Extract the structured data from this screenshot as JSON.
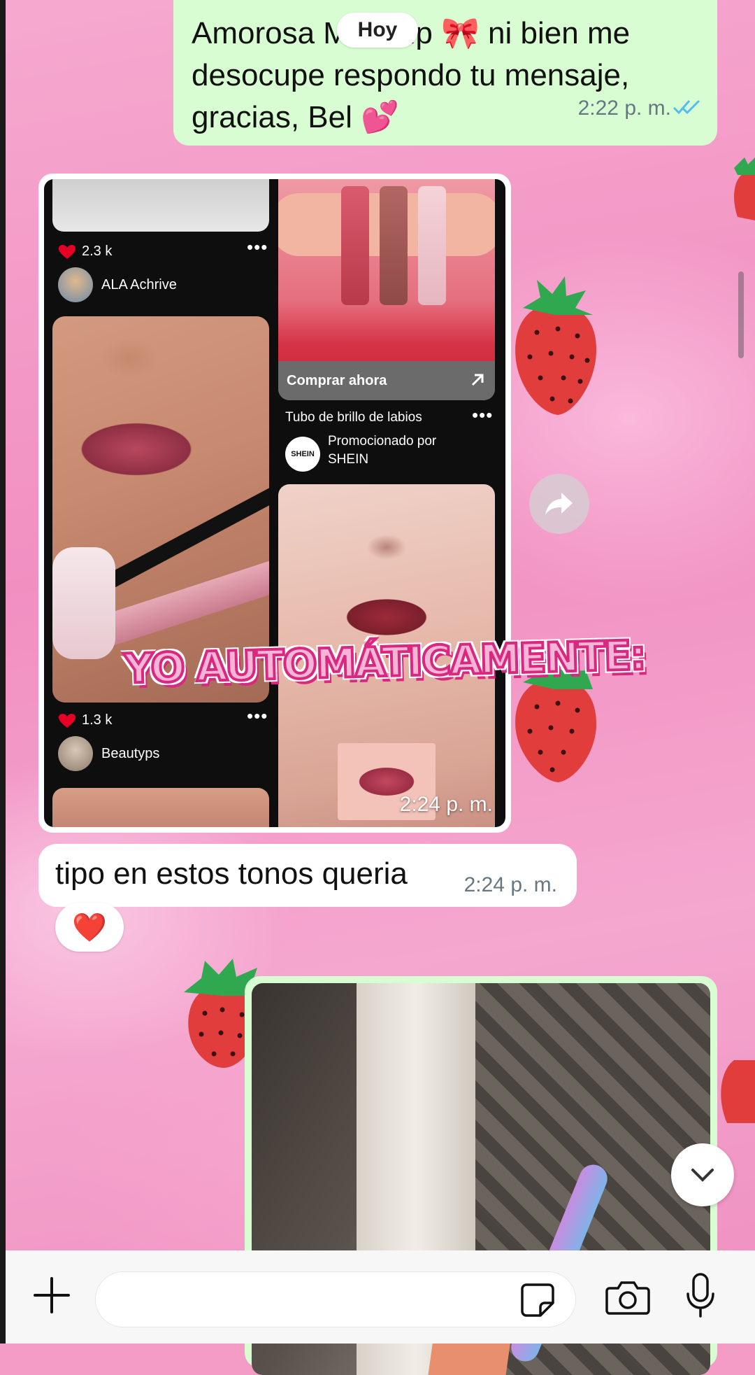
{
  "chat": {
    "date_pill": "Hoy",
    "outgoing_top": {
      "text": "Amorosa Makeup 🎀 ni bien me desocupe respondo tu mensaje, gracias, Bel 💕",
      "time": "2:22 p. m.",
      "status": "read-double-check"
    },
    "image_message": {
      "time": "2:24 p. m.",
      "pinterest": {
        "left_pin_1": {
          "likes": "2.3 k",
          "user": "ALA Achrive"
        },
        "right_pin_1": {
          "cta": "Comprar ahora",
          "title": "Tubo de brillo de labios",
          "promoted": "Promocionado por",
          "brand": "SHEIN",
          "brand_logo": "SHEIN"
        },
        "left_pin_2": {
          "likes": "1.3 k",
          "user": "Beautyps"
        }
      },
      "overlay_caption": "YO AUTOMÁTICAMENTE:"
    },
    "incoming_text": {
      "text": "tipo en estos tonos queria",
      "time": "2:24 p. m.",
      "reaction": "❤️"
    }
  },
  "composer": {
    "placeholder": "",
    "icons": [
      "plus-icon",
      "sticker-icon",
      "camera-icon",
      "mic-icon"
    ]
  },
  "colors": {
    "outgoing_bubble": "#d9fdd3",
    "incoming_bubble": "#ffffff",
    "wallpaper_pink": "#f29cc6",
    "read_tick": "#53bdeb"
  }
}
